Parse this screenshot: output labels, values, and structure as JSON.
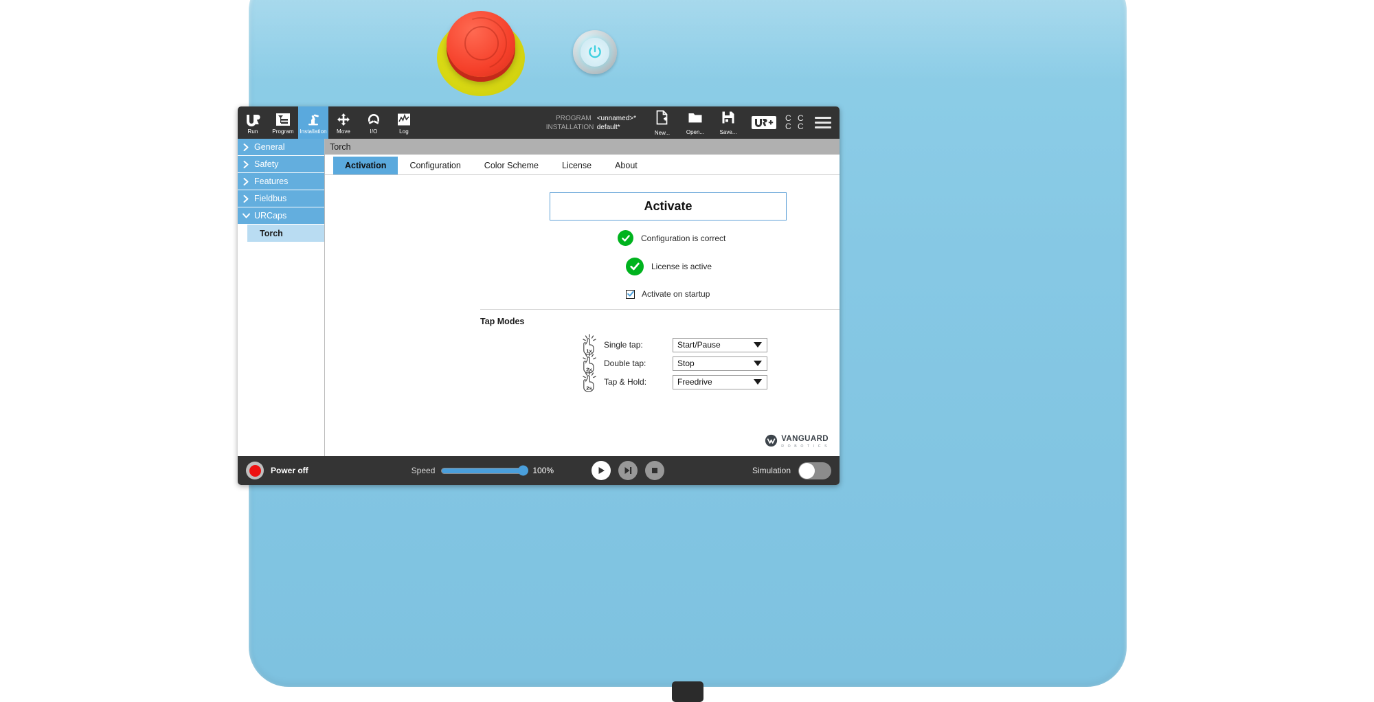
{
  "toolbar": {
    "buttons": [
      {
        "label": "Run",
        "icon": "ur-logo-icon",
        "active": false
      },
      {
        "label": "Program",
        "icon": "program-tree-icon",
        "active": false
      },
      {
        "label": "Installation",
        "icon": "robot-arm-icon",
        "active": true
      },
      {
        "label": "Move",
        "icon": "move-arrows-icon",
        "active": false
      },
      {
        "label": "I/O",
        "icon": "io-gauge-icon",
        "active": false
      },
      {
        "label": "Log",
        "icon": "log-graph-icon",
        "active": false
      }
    ],
    "program_key": "PROGRAM",
    "program_value": "<unnamed>*",
    "installation_key": "INSTALLATION",
    "installation_value": "default*",
    "file_buttons": [
      {
        "label": "New...",
        "icon": "new-file-icon"
      },
      {
        "label": "Open...",
        "icon": "open-folder-icon"
      },
      {
        "label": "Save...",
        "icon": "save-disk-icon"
      }
    ],
    "urplus_text": "UR+",
    "cc_cells": [
      "C",
      "C",
      "C",
      "C"
    ]
  },
  "sidebar": {
    "items": [
      {
        "label": "General",
        "chevron": "chevron-right-icon",
        "expanded": false
      },
      {
        "label": "Safety",
        "chevron": "chevron-right-icon",
        "expanded": false
      },
      {
        "label": "Features",
        "chevron": "chevron-right-icon",
        "expanded": false
      },
      {
        "label": "Fieldbus",
        "chevron": "chevron-right-icon",
        "expanded": false
      },
      {
        "label": "URCaps",
        "chevron": "chevron-down-icon",
        "expanded": true
      }
    ],
    "sub_item": "Torch"
  },
  "content": {
    "title": "Torch",
    "tabs": [
      {
        "label": "Activation",
        "active": true
      },
      {
        "label": "Configuration",
        "active": false
      },
      {
        "label": "Color Scheme",
        "active": false
      },
      {
        "label": "License",
        "active": false
      },
      {
        "label": "About",
        "active": false
      }
    ],
    "activate_button": "Activate",
    "status": [
      {
        "text": "Configuration is correct",
        "icon": "green-check-icon"
      },
      {
        "text": "License is active",
        "icon": "green-check-icon"
      }
    ],
    "startup_checkbox": {
      "label": "Activate on startup",
      "checked": true
    },
    "tap_modes_title": "Tap Modes",
    "tap_modes": [
      {
        "icon_badge": "1x",
        "label": "Single tap:",
        "value": "Start/Pause"
      },
      {
        "icon_badge": "2x",
        "label": "Double tap:",
        "value": "Stop"
      },
      {
        "icon_badge": "2s",
        "label": "Tap & Hold:",
        "value": "Freedrive"
      }
    ],
    "vendor_logo": {
      "name": "VANGUARD",
      "subtitle": "R O B O T I C S"
    }
  },
  "bottombar": {
    "power_label": "Power off",
    "speed_label": "Speed",
    "speed_value": "100%",
    "speed_percent": 100,
    "transport": [
      {
        "name": "play-button",
        "icon": "play-icon",
        "style": "primary"
      },
      {
        "name": "step-button",
        "icon": "step-forward-icon",
        "style": "dim"
      },
      {
        "name": "stop-button",
        "icon": "stop-icon",
        "style": "dim"
      }
    ],
    "simulation_label": "Simulation",
    "simulation_on": false
  },
  "hardware": {
    "estop_name": "emergency-stop-button",
    "power_button_name": "power-button"
  },
  "colors": {
    "accent_blue": "#5aa9dd",
    "shell_blue": "#86c8e4",
    "toolbar_dark": "#333333",
    "status_green": "#00b31e",
    "estop_red": "#f5402a"
  }
}
